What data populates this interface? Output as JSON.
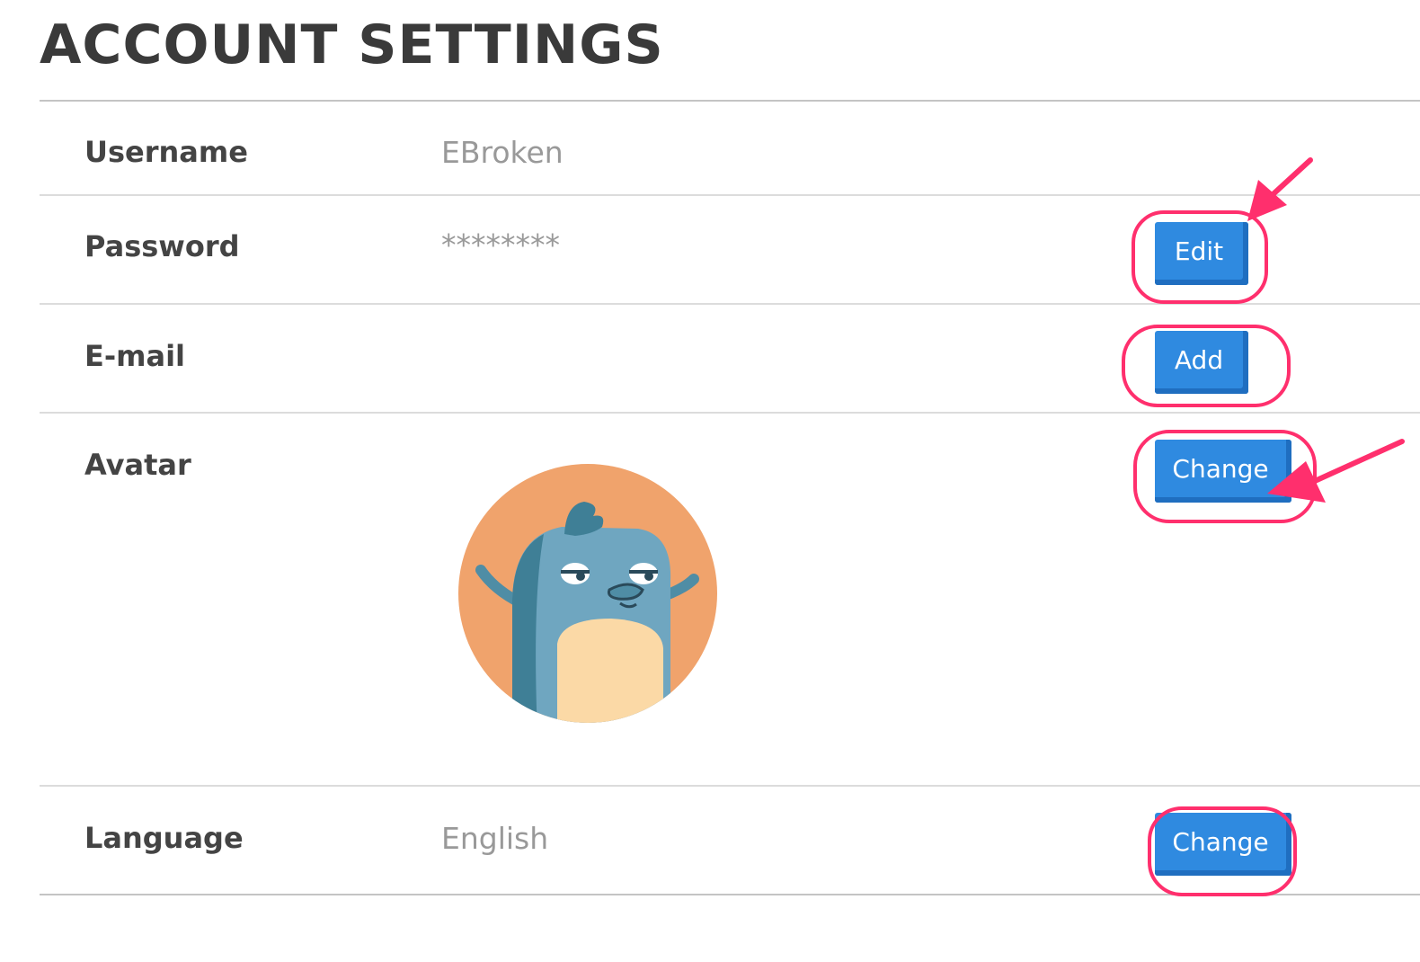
{
  "page": {
    "title": "ACCOUNT SETTINGS"
  },
  "rows": {
    "username": {
      "label": "Username",
      "value": "EBroken"
    },
    "password": {
      "label": "Password",
      "value": "********",
      "button": "Edit"
    },
    "email": {
      "label": "E-mail",
      "button": "Add"
    },
    "avatar": {
      "label": "Avatar",
      "button": "Change",
      "image": "platypus-avatar"
    },
    "language": {
      "label": "Language",
      "value": "English",
      "button": "Change"
    }
  },
  "colors": {
    "button": "#2f8ae0",
    "button_shadow": "#1f6ec0",
    "highlight": "#ff2f6d",
    "avatar_bg": "#f0a36c"
  }
}
